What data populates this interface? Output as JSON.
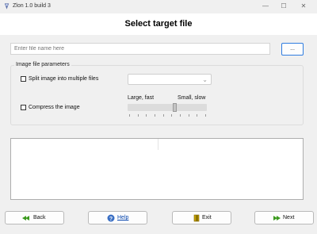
{
  "window": {
    "title": "Zlon 1.0 build 3",
    "minimize_glyph": "—",
    "maximize_glyph": "☐",
    "close_glyph": "✕"
  },
  "header": {
    "heading": "Select target file"
  },
  "file": {
    "placeholder": "Enter file name here",
    "value": "Enter file name here",
    "browse_label": "..."
  },
  "params": {
    "legend": "Image file parameters",
    "split": {
      "label": "Split image into multiple files",
      "checked": false,
      "selected_value": ""
    },
    "compress": {
      "label": "Compress the image",
      "checked": false
    },
    "slider": {
      "left_label": "Large, fast",
      "right_label": "Small, slow",
      "level": 0.6,
      "ticks": 10
    }
  },
  "buttons": {
    "back": "Back",
    "help": "Help",
    "exit": "Exit",
    "next": "Next"
  },
  "colors": {
    "accent": "#2f7de0",
    "link": "#0645ad",
    "exit_icon": "#c9a400",
    "arrow_icon": "#3c9a1f"
  },
  "icons": {
    "app": "app-icon",
    "back": "back-arrow-icon",
    "help": "help-icon",
    "exit": "exit-door-icon",
    "next": "next-arrow-icon"
  }
}
